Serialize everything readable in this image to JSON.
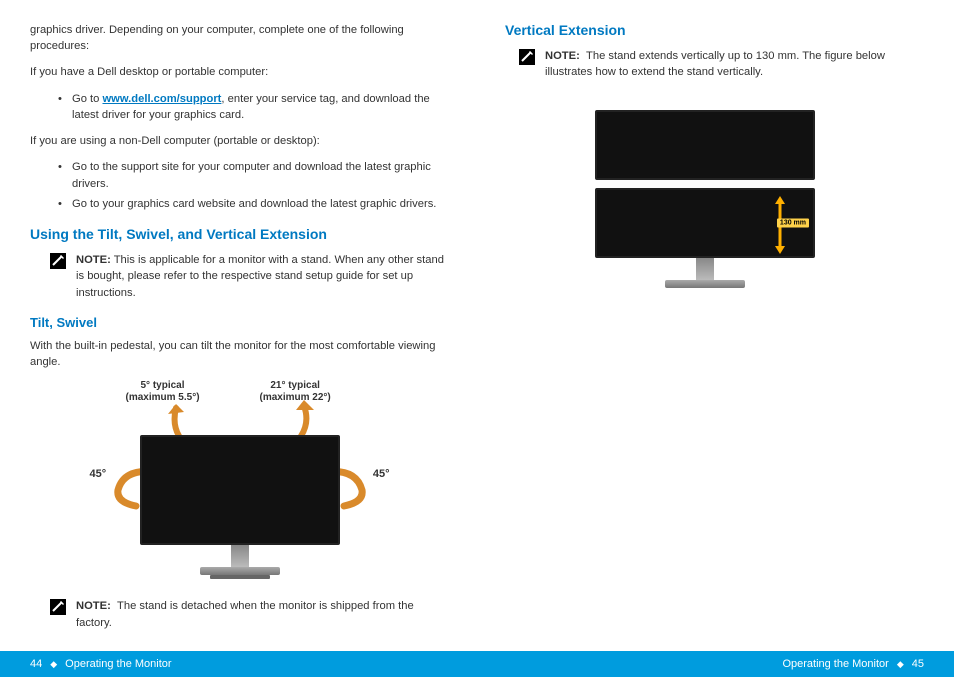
{
  "left": {
    "intro": "graphics driver. Depending on your computer, complete one of the following procedures:",
    "dell_heading": "If you have a Dell desktop or portable computer:",
    "dell_bullet_pre": "Go to ",
    "dell_link": "www.dell.com/support",
    "dell_bullet_post": ", enter your service tag, and download the latest driver for your graphics card.",
    "nondell_heading": "If you are using a non-Dell computer (portable or desktop):",
    "nondell_b1": "Go to the support site for your computer and download the latest graphic drivers.",
    "nondell_b2": "Go to your graphics card website and download the latest graphic drivers.",
    "h2": "Using the Tilt, Swivel, and Vertical Extension",
    "note1_label": "NOTE:",
    "note1_text": " This is applicable for a monitor with a stand. When any other stand is bought, please refer to the respective stand setup guide for set up instructions.",
    "h3": "Tilt, Swivel",
    "tilt_body": "With the built-in pedestal, you can tilt the monitor for the most comfortable viewing angle.",
    "fig": {
      "tilt_back_typ": "5° typical",
      "tilt_back_max": "(maximum 5.5°)",
      "tilt_fwd_typ": "21° typical",
      "tilt_fwd_max": "(maximum 22°)",
      "swivel_left": "45°",
      "swivel_right": "45°"
    },
    "note2_label": "NOTE:",
    "note2_text": "The stand is detached when the monitor is shipped from the factory.",
    "footer_page": "44",
    "footer_title": "Operating the Monitor"
  },
  "right": {
    "h2": "Vertical Extension",
    "note_label": "NOTE:",
    "note_text": "The stand extends vertically up to 130 mm. The figure below illustrates how to extend the stand vertically.",
    "fig_label": "130 mm",
    "footer_title": "Operating the Monitor",
    "footer_page": "45"
  }
}
